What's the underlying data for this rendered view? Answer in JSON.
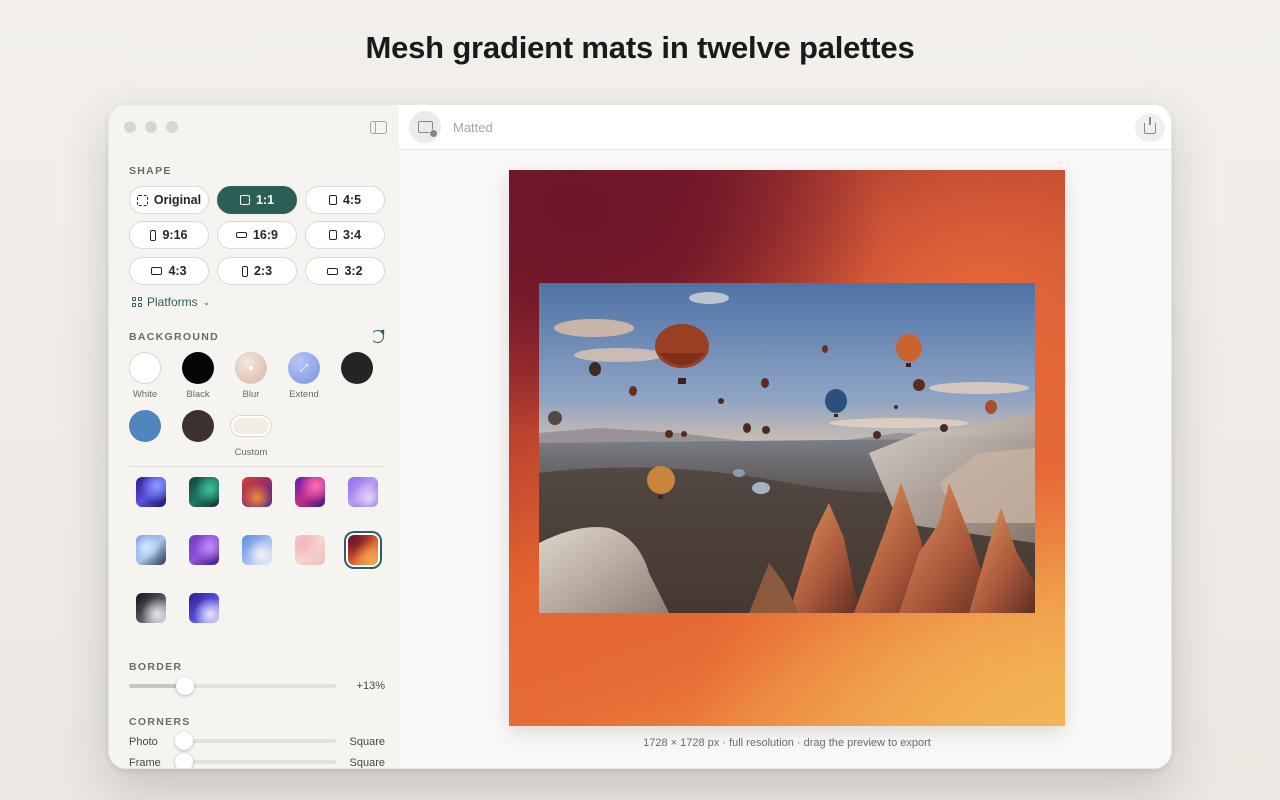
{
  "headline": "Mesh gradient mats in twelve palettes",
  "toolbar": {
    "title": "Matted"
  },
  "sidebar": {
    "shape_label": "SHAPE",
    "shapes": [
      {
        "label": "Original",
        "icon": "dashed-square-icon"
      },
      {
        "label": "1:1",
        "icon": "square-icon",
        "active": true
      },
      {
        "label": "4:5",
        "icon": "portrait-icon"
      },
      {
        "label": "9:16",
        "icon": "tall-icon"
      },
      {
        "label": "16:9",
        "icon": "wide-icon"
      },
      {
        "label": "3:4",
        "icon": "portrait-icon"
      },
      {
        "label": "4:3",
        "icon": "landscape-icon"
      },
      {
        "label": "2:3",
        "icon": "tall-icon"
      },
      {
        "label": "3:2",
        "icon": "landscape-icon"
      }
    ],
    "platforms_label": "Platforms",
    "background_label": "BACKGROUND",
    "backgrounds": [
      {
        "label": "White",
        "color": "#ffffff"
      },
      {
        "label": "Black",
        "color": "#050505"
      },
      {
        "label": "Blur"
      },
      {
        "label": "Extend"
      },
      {
        "label": "",
        "color": "#262423"
      },
      {
        "label": "",
        "color": "#4f86bd"
      },
      {
        "label": "",
        "color": "#3c3130"
      },
      {
        "label": "Custom"
      }
    ],
    "mesh_palette_count": 12,
    "mesh_selected_index": 9,
    "border_label": "BORDER",
    "border_value": "+13%",
    "border_level": 0.27,
    "corners_label": "CORNERS",
    "corners": [
      {
        "label": "Photo",
        "value": "Square",
        "level": 0
      },
      {
        "label": "Frame",
        "value": "Square",
        "level": 0
      }
    ]
  },
  "canvas": {
    "caption": "1728 × 1728 px · full resolution · drag the preview to export",
    "mat_colors": [
      "#6d1629",
      "#b23a2f",
      "#e3632f",
      "#f3b454"
    ]
  }
}
